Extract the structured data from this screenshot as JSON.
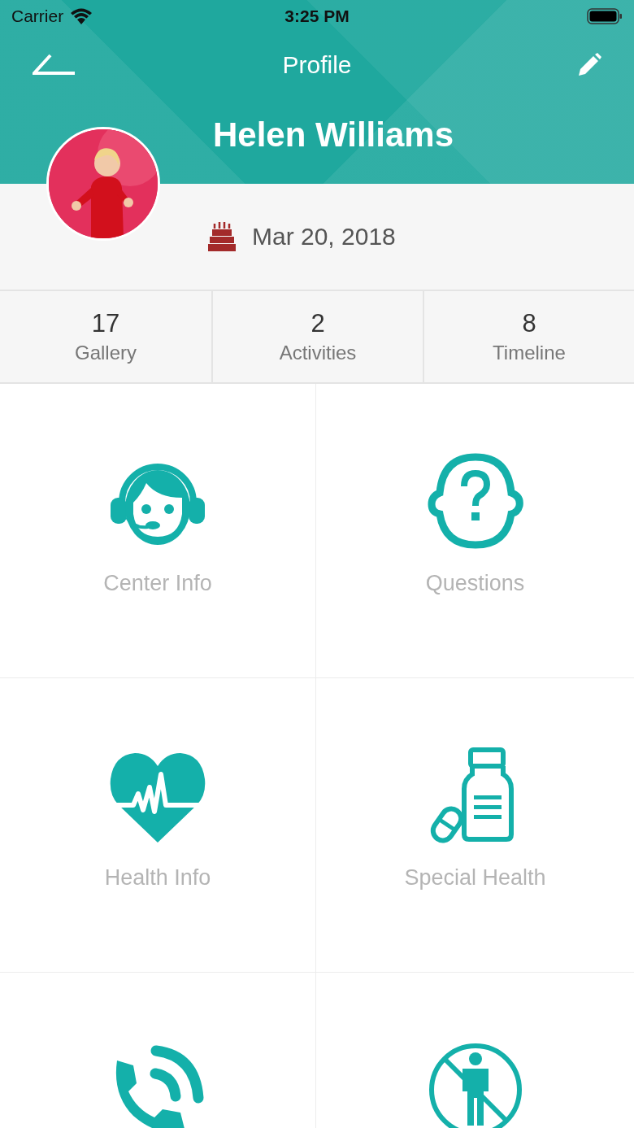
{
  "status_bar": {
    "carrier": "Carrier",
    "time": "3:25 PM"
  },
  "nav": {
    "title": "Profile"
  },
  "profile": {
    "name": "Helen Williams",
    "birthday": "Mar 20, 2018"
  },
  "stats": [
    {
      "count": "17",
      "label": "Gallery"
    },
    {
      "count": "2",
      "label": "Activities"
    },
    {
      "count": "8",
      "label": "Timeline"
    }
  ],
  "tiles": [
    {
      "kind": "headset",
      "label": "Center Info"
    },
    {
      "kind": "question",
      "label": "Questions"
    },
    {
      "kind": "heart",
      "label": "Health Info"
    },
    {
      "kind": "medicine",
      "label": "Special Health"
    },
    {
      "kind": "phone"
    },
    {
      "kind": "no-person"
    }
  ]
}
